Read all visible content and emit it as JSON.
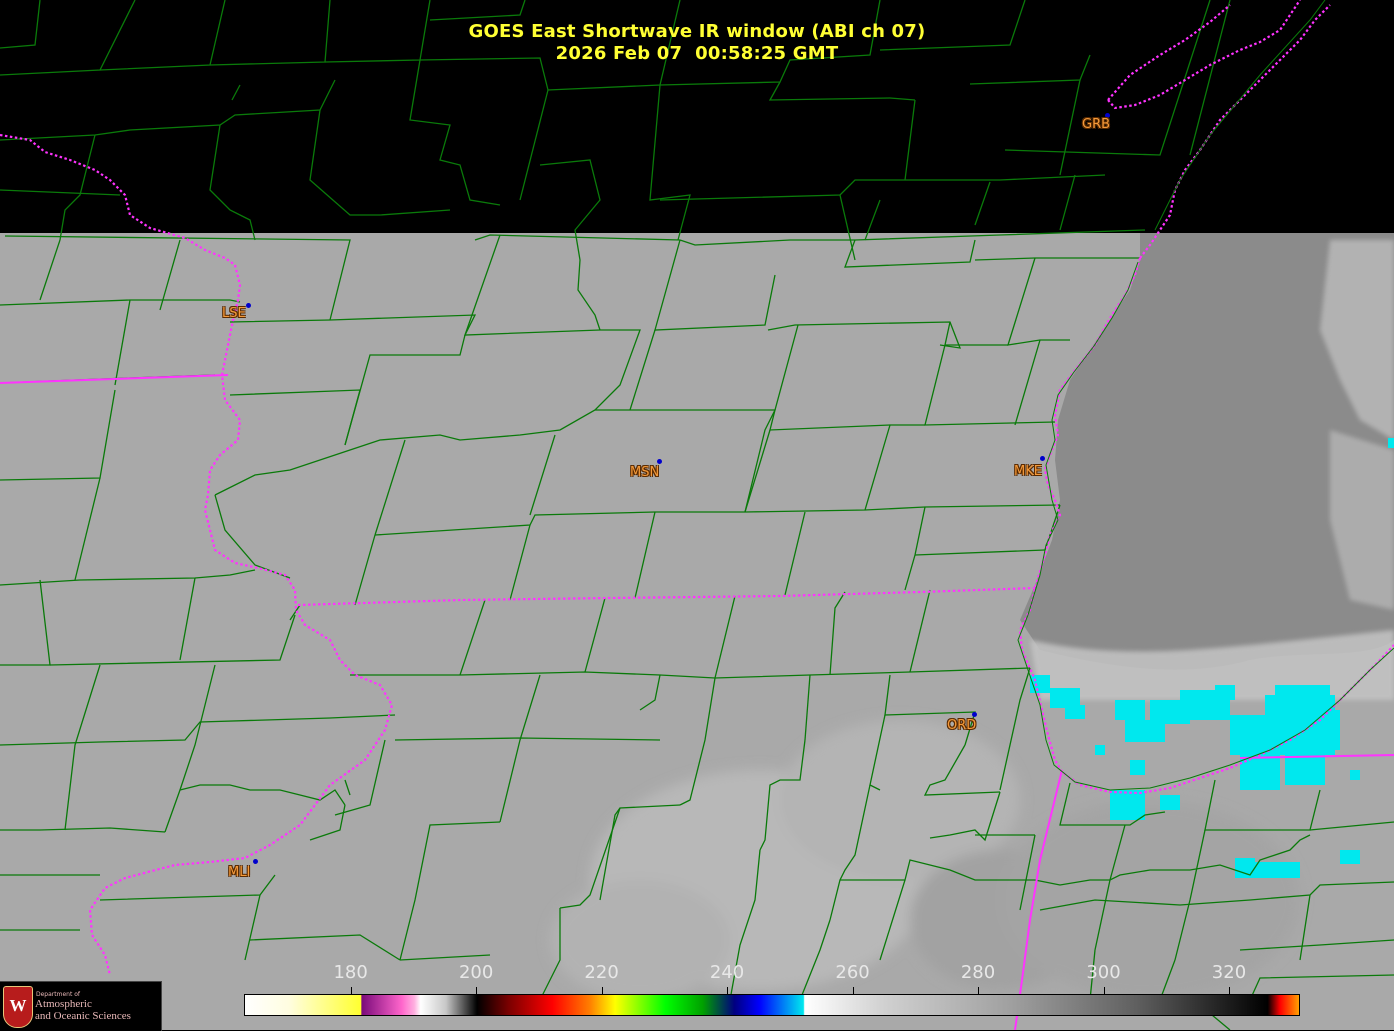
{
  "title": {
    "line1": "GOES East Shortwave IR window (ABI ch 07)",
    "line2": "2026 Feb 07  00:58:25 GMT"
  },
  "cities": [
    {
      "code": "GRB"
    },
    {
      "code": "LSE"
    },
    {
      "code": "MSN"
    },
    {
      "code": "MKE"
    },
    {
      "code": "ORD"
    },
    {
      "code": "MLI"
    }
  ],
  "colorbar": {
    "ticks": [
      "180",
      "200",
      "220",
      "240",
      "260",
      "280",
      "300",
      "320"
    ],
    "tick_values": [
      180,
      200,
      220,
      240,
      260,
      280,
      300,
      320
    ],
    "range": [
      163,
      331
    ],
    "colors": {
      "state_border": "#ff33ff",
      "county_border": "#0a7a0a",
      "title": "#ffff33",
      "city_label": "#f59a3a",
      "cold_cloud": "#00e8ee"
    }
  },
  "logo": {
    "dept": "Department of",
    "line1": "Atmospheric",
    "line2": "and Oceanic Sciences"
  }
}
